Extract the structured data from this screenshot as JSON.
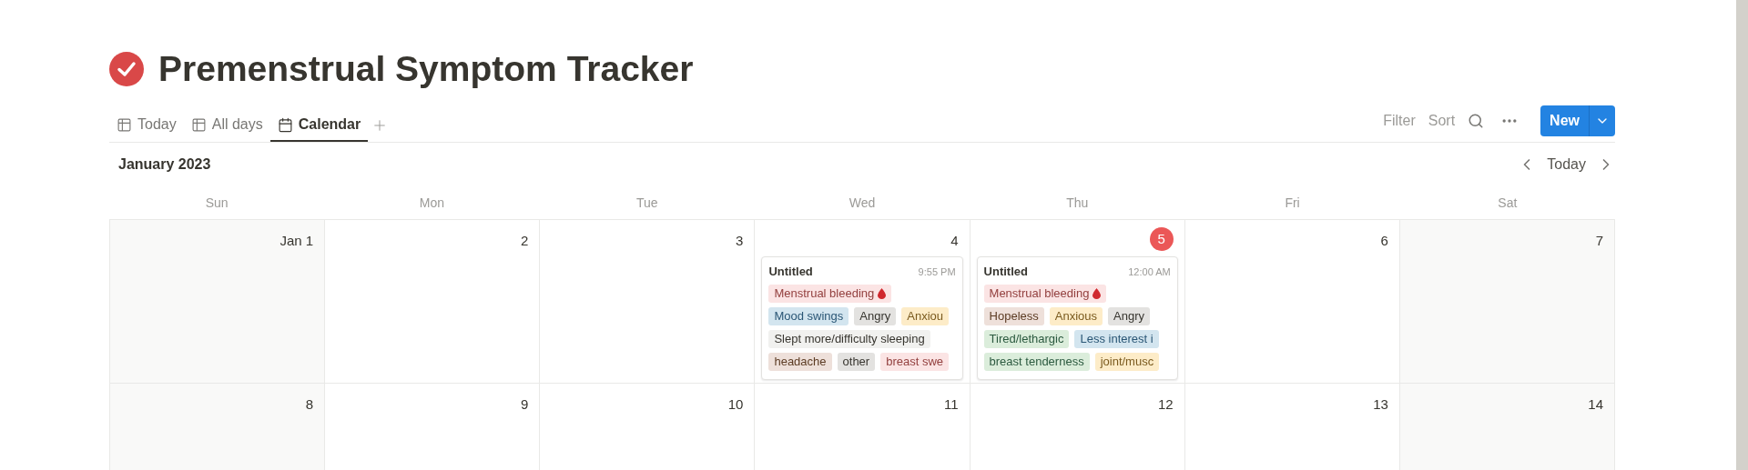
{
  "page": {
    "title": "Premenstrual Symptom Tracker"
  },
  "tabs": [
    {
      "label": "Today",
      "kind": "table",
      "selected": false
    },
    {
      "label": "All days",
      "kind": "table",
      "selected": false
    },
    {
      "label": "Calendar",
      "kind": "calendar",
      "selected": true
    }
  ],
  "toolbar": {
    "filter": "Filter",
    "sort": "Sort",
    "new_button": "New"
  },
  "calendar": {
    "month": "January 2023",
    "today_button": "Today",
    "weekdays": [
      "Sun",
      "Mon",
      "Tue",
      "Wed",
      "Thu",
      "Fri",
      "Sat"
    ],
    "weeks": [
      [
        {
          "label": "Jan 1",
          "today": false
        },
        {
          "label": "2",
          "today": false
        },
        {
          "label": "3",
          "today": false
        },
        {
          "label": "4",
          "today": false,
          "entry": {
            "title": "Untitled",
            "time": "9:55 PM",
            "tag_rows": [
              [
                {
                  "text": "Menstrual bleeding",
                  "color": "#fbe4e4",
                  "kind": "drop"
                }
              ],
              [
                {
                  "text": "Mood swings",
                  "color": "#d3e5ef",
                  "kind": "plain"
                },
                {
                  "text": "Angry",
                  "color": "#e3e2e0",
                  "kind": "plain"
                },
                {
                  "text": "Anxiou",
                  "color": "#fdecc8",
                  "kind": "plain"
                }
              ],
              [
                {
                  "text": "Slept more/difficulty sleeping",
                  "color": "#f1f1ef",
                  "kind": "plain"
                }
              ],
              [
                {
                  "text": "headache",
                  "color": "#eee0da",
                  "kind": "plain"
                },
                {
                  "text": "other",
                  "color": "#e3e2e0",
                  "kind": "plain"
                },
                {
                  "text": "breast swe",
                  "color": "#fbe4e4",
                  "kind": "plain"
                }
              ]
            ]
          }
        },
        {
          "label": "5",
          "today": true,
          "entry": {
            "title": "Untitled",
            "time": "12:00 AM",
            "tag_rows": [
              [
                {
                  "text": "Menstrual bleeding",
                  "color": "#fbe4e4",
                  "kind": "drop"
                }
              ],
              [
                {
                  "text": "Hopeless",
                  "color": "#eee0da",
                  "kind": "plain"
                },
                {
                  "text": "Anxious",
                  "color": "#fdecc8",
                  "kind": "plain"
                },
                {
                  "text": "Angry",
                  "color": "#e3e2e0",
                  "kind": "plain"
                }
              ],
              [
                {
                  "text": "Tired/lethargic",
                  "color": "#dbeddb",
                  "kind": "plain"
                },
                {
                  "text": "Less interest i",
                  "color": "#d3e5ef",
                  "kind": "plain"
                }
              ],
              [
                {
                  "text": "breast tenderness",
                  "color": "#dbeddb",
                  "kind": "plain"
                },
                {
                  "text": "joint/musc",
                  "color": "#fdecc8",
                  "kind": "plain"
                }
              ]
            ]
          }
        },
        {
          "label": "6",
          "today": false
        },
        {
          "label": "7",
          "today": false
        }
      ],
      [
        {
          "label": "8",
          "today": false
        },
        {
          "label": "9",
          "today": false
        },
        {
          "label": "10",
          "today": false
        },
        {
          "label": "11",
          "today": false
        },
        {
          "label": "12",
          "today": false
        },
        {
          "label": "13",
          "today": false
        },
        {
          "label": "14",
          "today": false
        }
      ]
    ]
  }
}
